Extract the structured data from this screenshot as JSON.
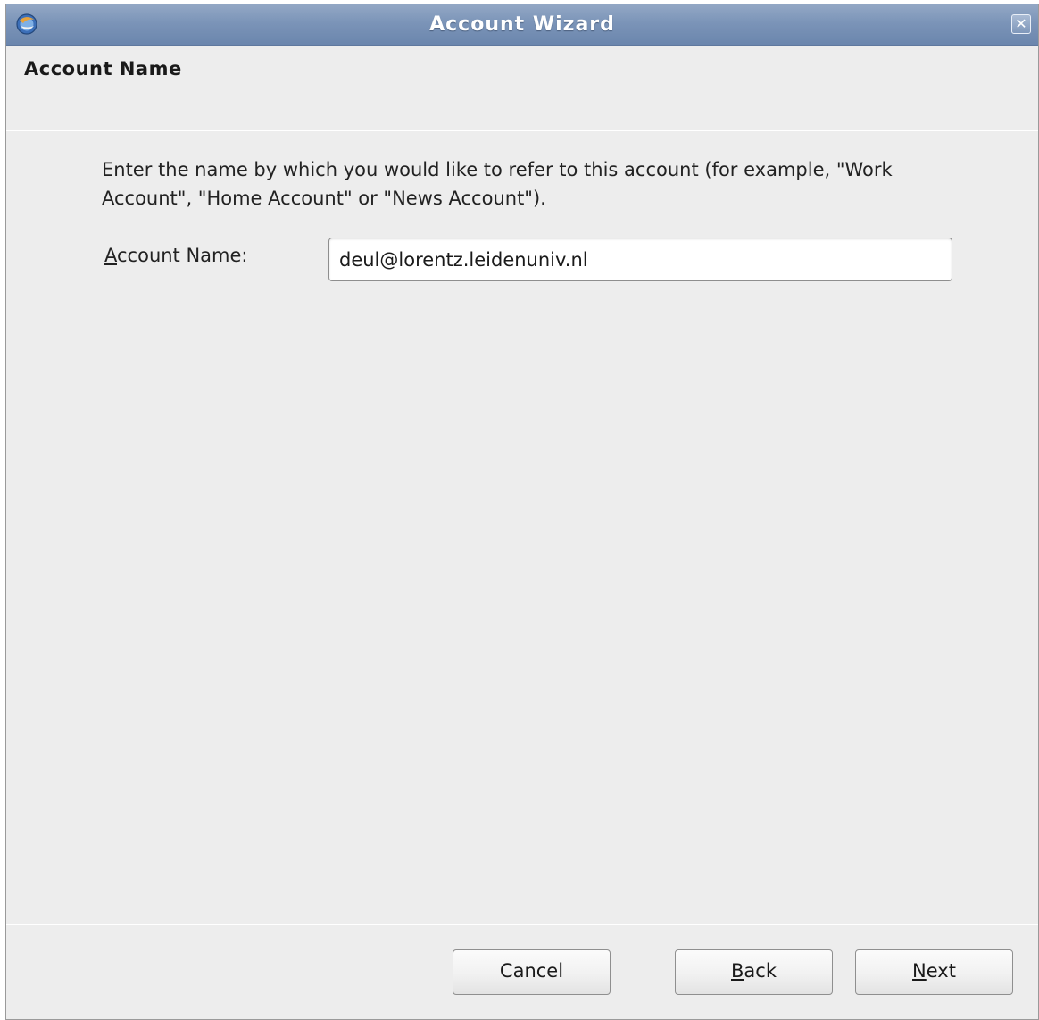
{
  "window": {
    "title": "Account Wizard",
    "close_symbol": "✕"
  },
  "page": {
    "header": "Account Name",
    "description": "Enter the name by which you would like to refer to this account (for example, \"Work Account\", \"Home Account\" or \"News Account\")."
  },
  "form": {
    "label_mnemonic": "A",
    "label_rest": "ccount Name:",
    "value": "deul@lorentz.leidenuniv.nl"
  },
  "buttons": {
    "cancel": "Cancel",
    "back_mnemonic": "B",
    "back_rest": "ack",
    "next_mnemonic": "N",
    "next_rest": "ext"
  },
  "icons": {
    "app": "thunderbird-icon",
    "close": "close-icon"
  },
  "colors": {
    "titlebar": "#7b94b8",
    "window_bg": "#ededed"
  }
}
